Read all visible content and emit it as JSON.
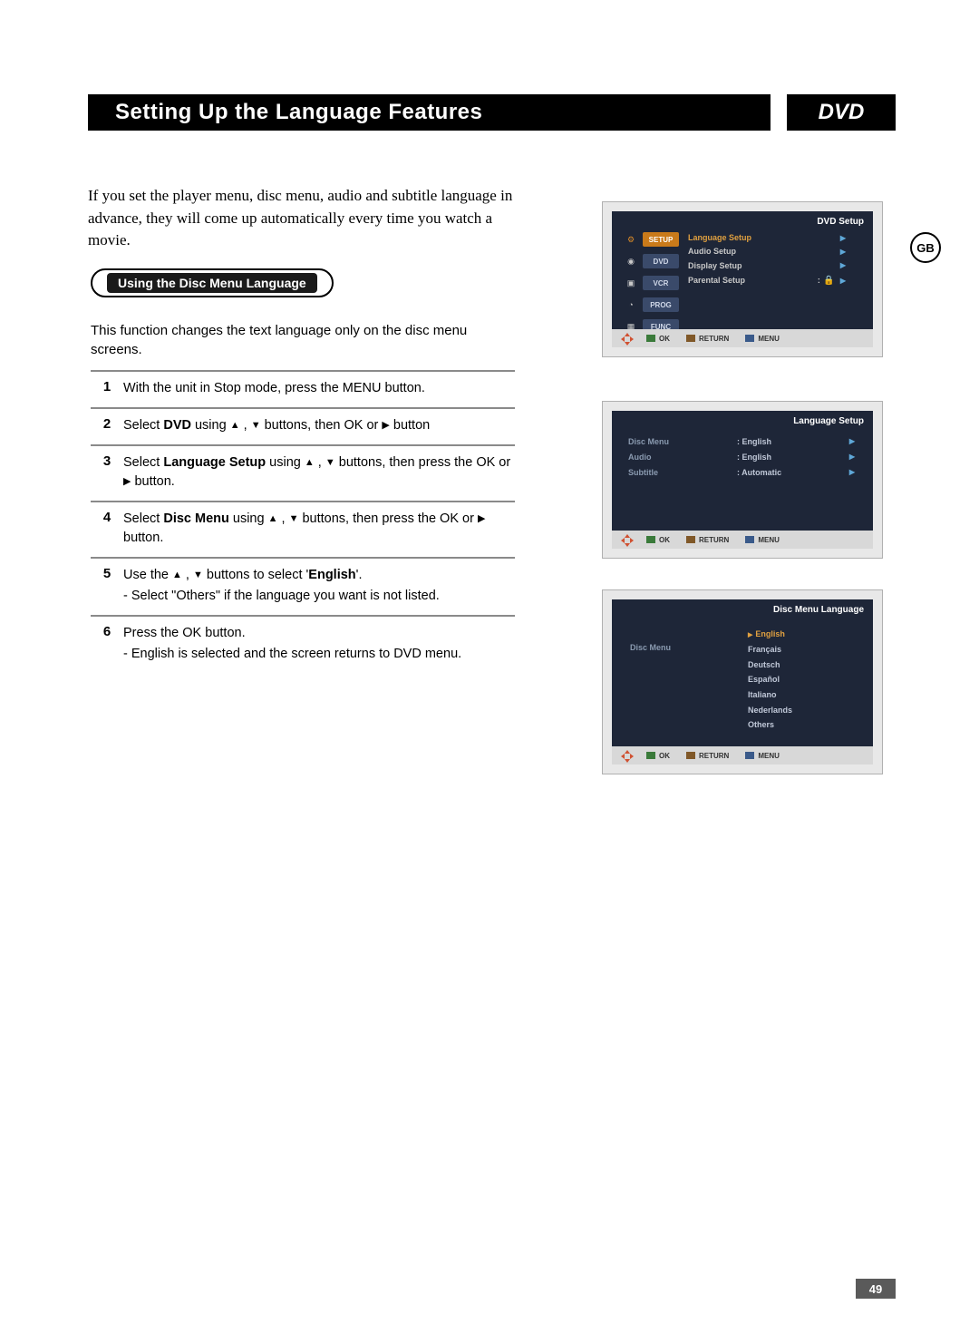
{
  "title": "Setting Up the Language Features",
  "badge": "DVD",
  "region": "GB",
  "intro": "If you set the player menu, disc menu, audio and subtitle language in advance, they will come up automatically every time you watch a movie.",
  "capsule": "Using the Disc Menu Language",
  "desc": "This function changes the text language only on the disc menu screens.",
  "steps": [
    {
      "n": "1",
      "html": "With the unit in Stop mode, press the MENU button."
    },
    {
      "n": "2",
      "html": "Select <b>DVD</b> using <span class='tri'>▲</span> , <span class='tri'>▼</span> buttons, then OK or <span class='tri'>▶</span> button"
    },
    {
      "n": "3",
      "html": "Select <b>Language Setup</b> using <span class='tri'>▲</span> , <span class='tri'>▼</span> buttons, then press the OK or <span class='tri'>▶</span> button."
    },
    {
      "n": "4",
      "html": "Select <b>Disc Menu</b> using <span class='tri'>▲</span> , <span class='tri'>▼</span> buttons, then press the  OK or <span class='tri'>▶</span> button."
    },
    {
      "n": "5",
      "html": "Use the <span class='tri'>▲</span> , <span class='tri'>▼</span> buttons to select '<b>English</b>'.<span class='sub'>- Select \"Others\" if the language you want is not listed.</span>"
    },
    {
      "n": "6",
      "html": "Press the OK button.<span class='sub'>- English is selected and the screen returns to DVD menu.</span>"
    }
  ],
  "osd1": {
    "title": "DVD Setup",
    "sidebar": [
      "SETUP",
      "DVD",
      "VCR",
      "PROG",
      "FUNC"
    ],
    "sidebar_icons": [
      "⚙",
      "◉",
      "▣",
      "◔",
      "▦"
    ],
    "items": [
      "Language Setup",
      "Audio Setup",
      "Display Setup",
      "Parental Setup"
    ],
    "parental_sep": ":",
    "lock": "🔒"
  },
  "osd2": {
    "title": "Language Setup",
    "rows": [
      {
        "name": "Disc Menu",
        "val": ": English"
      },
      {
        "name": "Audio",
        "val": ": English"
      },
      {
        "name": "Subtitle",
        "val": ": Automatic"
      }
    ]
  },
  "osd3": {
    "title": "Disc Menu Language",
    "left": "Disc Menu",
    "langs": [
      "English",
      "Français",
      "Deutsch",
      "Español",
      "Italiano",
      "Nederlands",
      "Others"
    ]
  },
  "footer": {
    "ok": "OK",
    "return": "RETURN",
    "menu": "MENU"
  },
  "page": "49"
}
